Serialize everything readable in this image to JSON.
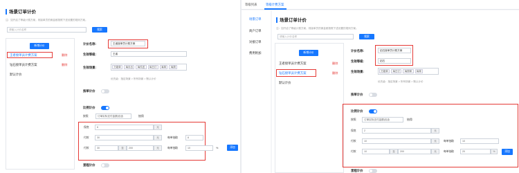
{
  "left": {
    "title": "场景订单计价",
    "hint": "注：如开启了等级计费方案，则接单员的佣金都按照下述设置的规则方案。",
    "search_placeholder": "请输入计价名称",
    "search_btn": "搜索",
    "new_btn": "新增计价",
    "plans": [
      {
        "name": "王者接单员计费方案",
        "del": "删除"
      },
      {
        "name": "钻石接单员计费方案",
        "del": "删除"
      },
      {
        "name": "默认计价",
        "del": ""
      }
    ],
    "form": {
      "name_label": "计价名称:",
      "name_value": "王者接单员计费方案",
      "level_label": "生效等级:",
      "level_value": "王者",
      "scene_label": "生效场景:",
      "scene_tags": [
        "万能单",
        "每月出",
        "每件送",
        "每日订",
        "每单",
        "每周"
      ],
      "priority": "优先级：指定场景 > 所有场景 > 默认计价",
      "appoint_label": "按单计价",
      "ratio_label": "比例计价",
      "fixed_prefix": "按照",
      "fixed_select": "订单实际支付金额(包含",
      "fixed_suffix": "抽佣",
      "baseline_label": "保底",
      "baseline_value": "6",
      "unit_yuan": "元",
      "row1": {
        "label": "付款",
        "v1": "30",
        "unit": "元",
        "rate_label": "每单抽取",
        "rate": "8"
      },
      "row2": {
        "label": "付款",
        "v1": "30",
        "mid": "至",
        "v2": "200",
        "unit": "元",
        "rate_label": "每单抽取",
        "rate": "10",
        "pct": "%",
        "add": "添加"
      },
      "bottom_label": "里程计价"
    }
  },
  "right": {
    "tabs": [
      "等级列表",
      "等级计费方案"
    ],
    "side": [
      "场景订单",
      "商户订单",
      "对接订单",
      "费用附加"
    ],
    "title": "场景订单计价",
    "hint": "注：如开启了等级计费方案，则接单员的佣金都按照下述设置的规则方案。",
    "search_placeholder": "请输入计价名称",
    "search_btn": "搜索",
    "new_btn": "新增计价",
    "plans": [
      {
        "name": "王者接单员计费方案",
        "del": "删除"
      },
      {
        "name": "钻石接单员计费方案",
        "del": "删除"
      },
      {
        "name": "默认计价",
        "del": ""
      }
    ],
    "form": {
      "name_label": "计价名称:",
      "name_value": "钻石接单员计费方案",
      "level_label": "生效等级:",
      "level_value": "钻石",
      "scene_label": "生效场景:",
      "scene_tags": [
        "万能单",
        "每日订",
        "每周单",
        "每单"
      ],
      "priority": "优先级：指定场景 > 所有场景 > 默认计价",
      "appoint_label": "按单计价",
      "ratio_label": "比例计价",
      "fixed_prefix": "按照",
      "fixed_select": "订单实际支付金额(包含",
      "fixed_suffix": "抽佣",
      "baseline_label": "保底",
      "baseline_value": "2",
      "unit_yuan": "元",
      "row1": {
        "label": "付款",
        "v1": "10",
        "unit": "元",
        "rate_label": "每单抽取",
        "rate": "10"
      },
      "row2": {
        "label": "付款",
        "v1": "10",
        "mid": "至",
        "v2": "200",
        "unit": "元",
        "rate_label": "每单抽取",
        "rate": "20",
        "pct": "%",
        "add": "添加"
      },
      "bottom_label": "里程计价"
    }
  },
  "colors": {
    "accent": "#1677ff",
    "danger": "#e53935"
  }
}
